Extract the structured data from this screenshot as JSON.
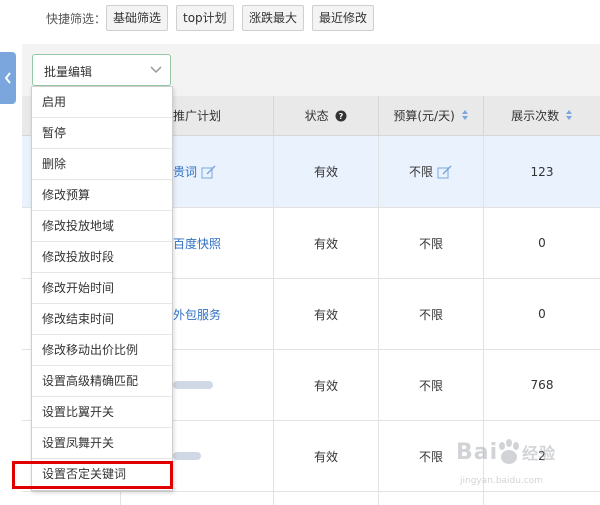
{
  "quick_filter": {
    "label": "快捷筛选：",
    "buttons": [
      "基础筛选",
      "top计划",
      "涨跌最大",
      "最近修改"
    ]
  },
  "toolbar": {
    "batch_edit": "批量编辑"
  },
  "table": {
    "headers": {
      "plan": "推广计划",
      "status": "状态",
      "budget": "预算(元/天)",
      "impressions": "展示次数"
    },
    "rows": [
      {
        "plan": "贵词",
        "status": "有效",
        "budget": "不限",
        "impressions": "123"
      },
      {
        "plan": "百度快照",
        "status": "有效",
        "budget": "不限",
        "impressions": "0"
      },
      {
        "plan": "外包服务",
        "status": "有效",
        "budget": "不限",
        "impressions": "0"
      },
      {
        "plan": "",
        "status": "有效",
        "budget": "不限",
        "impressions": "768"
      },
      {
        "plan": "",
        "status": "有效",
        "budget": "不限",
        "impressions": "2"
      },
      {
        "plan": "",
        "status": "",
        "budget": "",
        "impressions": ""
      }
    ]
  },
  "menu": {
    "items": [
      "启用",
      "暂停",
      "删除",
      "修改预算",
      "修改投放地域",
      "修改投放时段",
      "修改开始时间",
      "修改结束时间",
      "修改移动出价比例",
      "设置高级精确匹配",
      "设置比翼开关",
      "设置凤舞开关",
      "设置否定关键词"
    ],
    "highlighted_item": "设置否定关键词"
  },
  "watermark": {
    "brand": "Bai",
    "brand_cn": "经验",
    "url": "jingyan.baidu.com"
  },
  "colors": {
    "link": "#2f6fc4",
    "highlight_row": "#eaf2fd",
    "red_box": "#e00000",
    "select_border": "#93c9a4"
  }
}
